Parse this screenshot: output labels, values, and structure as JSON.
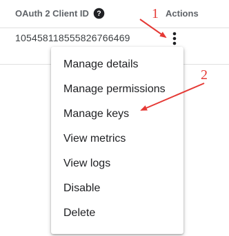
{
  "table": {
    "columns": {
      "client_id_header": "OAuth 2 Client ID",
      "actions_header": "Actions"
    },
    "help_icon": "help-icon",
    "rows": [
      {
        "client_id": "105458118555826766469",
        "actions_icon": "more-vert-icon"
      }
    ]
  },
  "menu": {
    "items": [
      {
        "label": "Manage details"
      },
      {
        "label": "Manage permissions"
      },
      {
        "label": "Manage keys"
      },
      {
        "label": "View metrics"
      },
      {
        "label": "View logs"
      },
      {
        "label": "Disable"
      },
      {
        "label": "Delete"
      }
    ]
  },
  "annotations": {
    "step1": "1",
    "step2": "2",
    "color": "#e53935"
  }
}
